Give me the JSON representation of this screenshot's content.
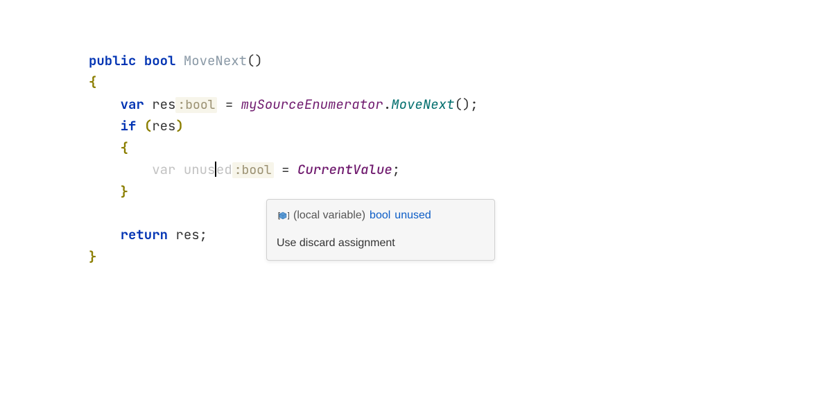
{
  "code": {
    "kw_public": "public",
    "kw_bool": "bool",
    "method_name": "MoveNext",
    "parens": "()",
    "brace_open": "{",
    "brace_close": "}",
    "kw_var": "var",
    "res": "res",
    "hint_bool": ":bool",
    "eq": " = ",
    "source_enum": "mySourceEnumerator",
    "dot": ".",
    "move_next": "MoveNext",
    "call_parens": "()",
    "semicolon": ";",
    "kw_if": "if",
    "if_open": "(",
    "if_close": ")",
    "unused_pre": "unus",
    "unused_post": "ed",
    "current_value": "CurrentValue",
    "kw_return": "return"
  },
  "tooltip": {
    "local_var_label": "(local variable)",
    "type_text": "bool",
    "var_name": "unused",
    "quick_fix": "Use discard assignment"
  }
}
